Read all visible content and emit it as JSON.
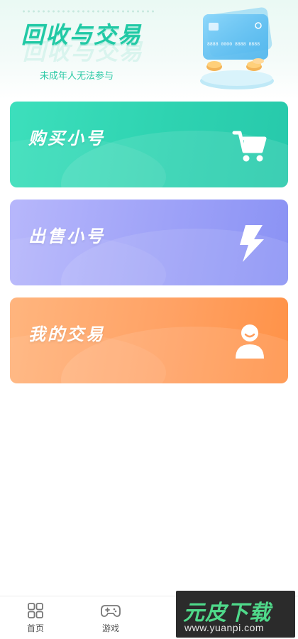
{
  "header": {
    "title": "回收与交易",
    "subtitle": "未成年人无法参与",
    "card_number": "8888 0000 8888 8888"
  },
  "tiles": [
    {
      "id": "buy",
      "label": "购买小号",
      "icon": "cart-icon"
    },
    {
      "id": "sell",
      "label": "出售小号",
      "icon": "lightning-icon"
    },
    {
      "id": "mine",
      "label": "我的交易",
      "icon": "user-icon"
    }
  ],
  "tabbar": {
    "items": [
      {
        "label": "首页",
        "icon": "grid-icon"
      },
      {
        "label": "游戏",
        "icon": "gamepad-icon"
      }
    ]
  },
  "watermark": {
    "title": "元皮下载",
    "url": "www.yuanpi.com"
  },
  "colors": {
    "accent": "#21c9a5",
    "buy_tile": "#2ed3b1",
    "sell_tile": "#9ea2f8",
    "mine_tile": "#ffa265"
  }
}
